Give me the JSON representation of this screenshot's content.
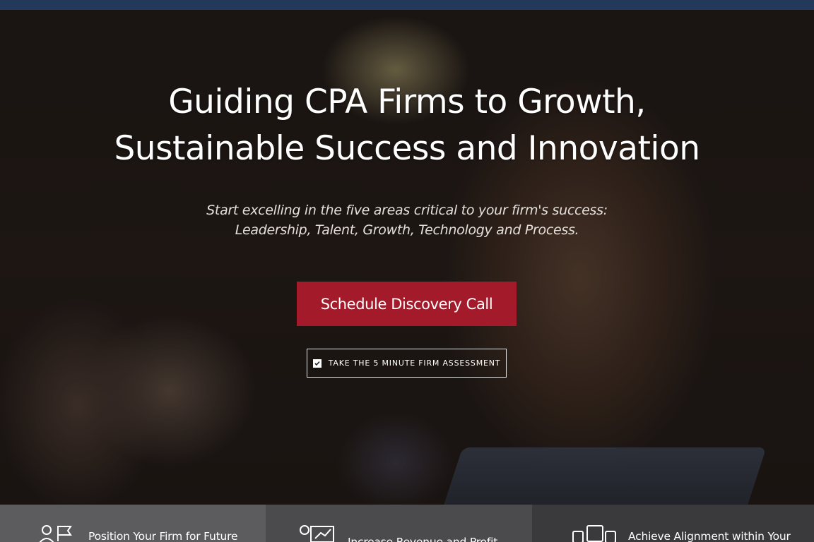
{
  "hero": {
    "title_line1": "Guiding CPA Firms to Growth,",
    "title_line2": "Sustainable Success and Innovation",
    "subtitle_line1": "Start excelling in the five areas critical to your firm's success:",
    "subtitle_line2": "Leadership, Talent, Growth, Technology and Process.",
    "primary_cta": "Schedule Discovery Call",
    "secondary_cta": "TAKE THE 5 MINUTE FIRM ASSESSMENT",
    "secondary_cta_icon": "checkbox-icon"
  },
  "features": [
    {
      "label": "Position Your Firm for Future",
      "icon": "people-flag-icon"
    },
    {
      "label": "Increase Revenue and Profit",
      "icon": "chart-board-icon"
    },
    {
      "label": "Achieve Alignment within Your",
      "icon": "team-devices-icon"
    }
  ],
  "colors": {
    "topbar": "#23395a",
    "primary_button": "#a31b2a",
    "feature_1_bg": "#5c5c5e",
    "feature_2_bg": "#4b4b4d",
    "feature_3_bg": "#3a3a3c"
  }
}
